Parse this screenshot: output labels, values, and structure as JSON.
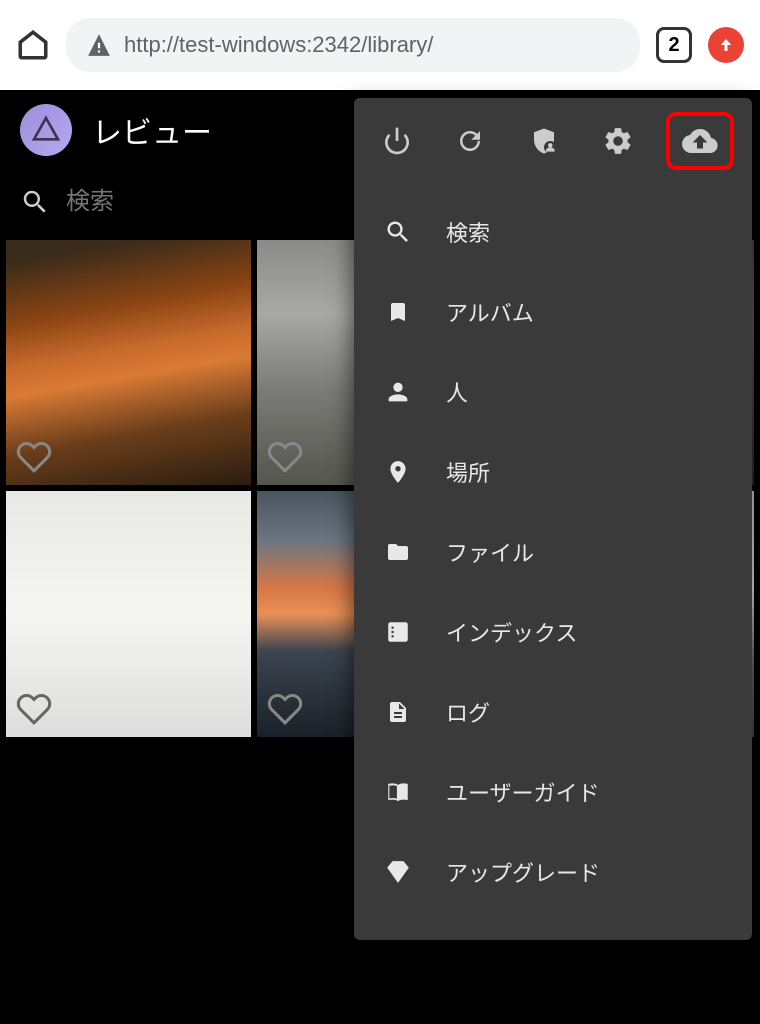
{
  "browser": {
    "url": "http://test-windows:2342/library/",
    "tab_count": "2"
  },
  "app": {
    "title": "レビュー",
    "search_placeholder": "検索"
  },
  "menu": {
    "items": [
      {
        "icon": "search",
        "label": "検索"
      },
      {
        "icon": "bookmark",
        "label": "アルバム"
      },
      {
        "icon": "person",
        "label": "人"
      },
      {
        "icon": "location",
        "label": "場所"
      },
      {
        "icon": "folder",
        "label": "ファイル"
      },
      {
        "icon": "index",
        "label": "インデックス"
      },
      {
        "icon": "document",
        "label": "ログ"
      },
      {
        "icon": "book",
        "label": "ユーザーガイド"
      },
      {
        "icon": "diamond",
        "label": "アップグレード"
      }
    ]
  }
}
